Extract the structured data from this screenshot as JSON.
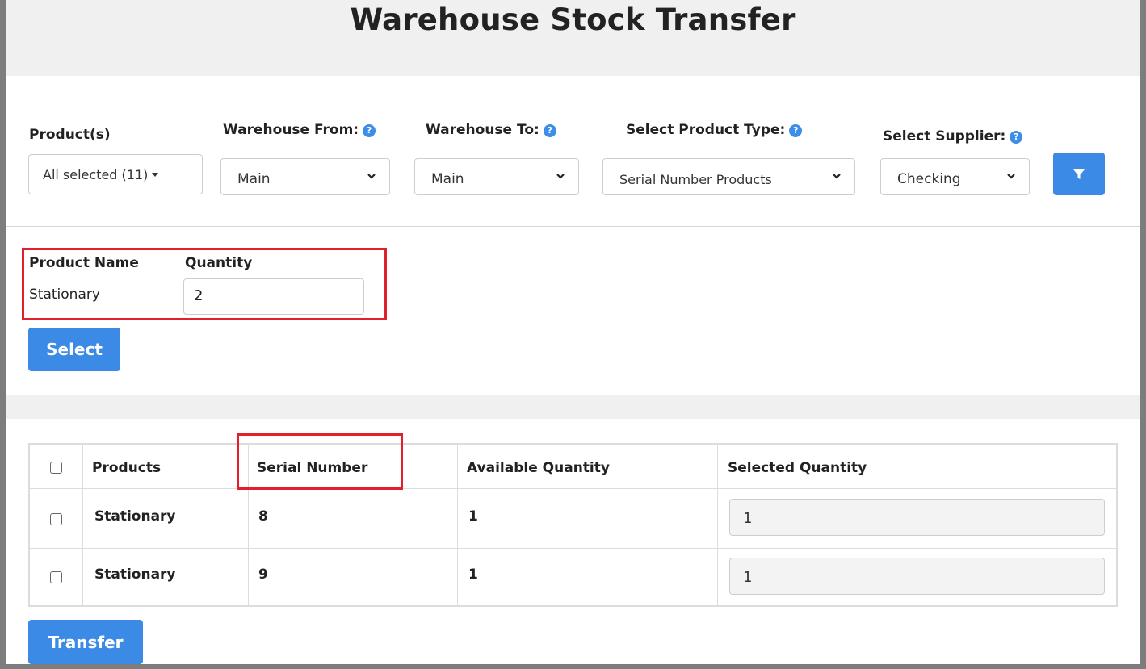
{
  "page": {
    "title": "Warehouse Stock Transfer"
  },
  "filters": {
    "products": {
      "label": "Product(s)",
      "value": "All selected (11)"
    },
    "warehouse_from": {
      "label": "Warehouse From:",
      "value": "Main"
    },
    "warehouse_to": {
      "label": "Warehouse To:",
      "value": "Main"
    },
    "product_type": {
      "label": "Select Product Type:",
      "value": "Serial Number Products"
    },
    "supplier": {
      "label": "Select Supplier:",
      "value": "Checking"
    },
    "filter_button_icon": "filter-icon"
  },
  "selection": {
    "product_name_header": "Product Name",
    "quantity_header": "Quantity",
    "product_name": "Stationary",
    "quantity": "2",
    "select_label": "Select"
  },
  "table": {
    "columns": [
      "Products",
      "Serial Number",
      "Available Quantity",
      "Selected Quantity"
    ],
    "rows": [
      {
        "product": "Stationary",
        "serial": "8",
        "available": "1",
        "selected": "1"
      },
      {
        "product": "Stationary",
        "serial": "9",
        "available": "1",
        "selected": "1"
      }
    ]
  },
  "actions": {
    "transfer_label": "Transfer"
  },
  "colors": {
    "accent": "#3b8ae6",
    "highlight": "#e0202a",
    "help": "#3c8ee6"
  }
}
